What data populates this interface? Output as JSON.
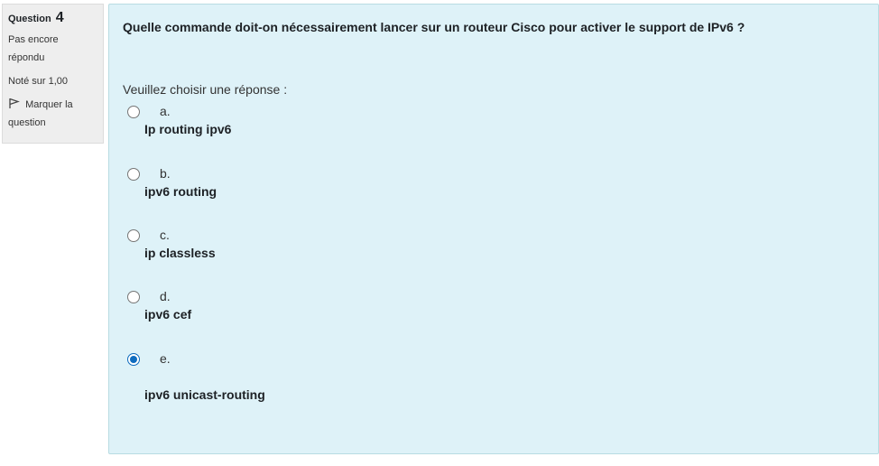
{
  "info": {
    "question_label": "Question",
    "question_number": "4",
    "state_line1": "Pas encore",
    "state_line2": "répondu",
    "grade": "Noté sur 1,00",
    "flag_line1": "Marquer la",
    "flag_line2": "question"
  },
  "question": {
    "text": "Quelle commande doit-on nécessairement lancer sur un routeur Cisco pour activer le support de IPv6 ?",
    "prompt": "Veuillez choisir une réponse :"
  },
  "answers": [
    {
      "letter": "a.",
      "text": "Ip routing ipv6",
      "checked": false
    },
    {
      "letter": "b.",
      "text": "ipv6 routing",
      "checked": false
    },
    {
      "letter": "c.",
      "text": "ip classless",
      "checked": false
    },
    {
      "letter": "d.",
      "text": "ipv6 cef",
      "checked": false
    },
    {
      "letter": "e.",
      "text": "ipv6 unicast-routing",
      "checked": true
    }
  ],
  "colors": {
    "content_bg": "#def2f8",
    "info_bg": "#eeeeee",
    "radio_checked": "#0f6cbf"
  },
  "icons": {
    "flag": "flag-icon"
  }
}
